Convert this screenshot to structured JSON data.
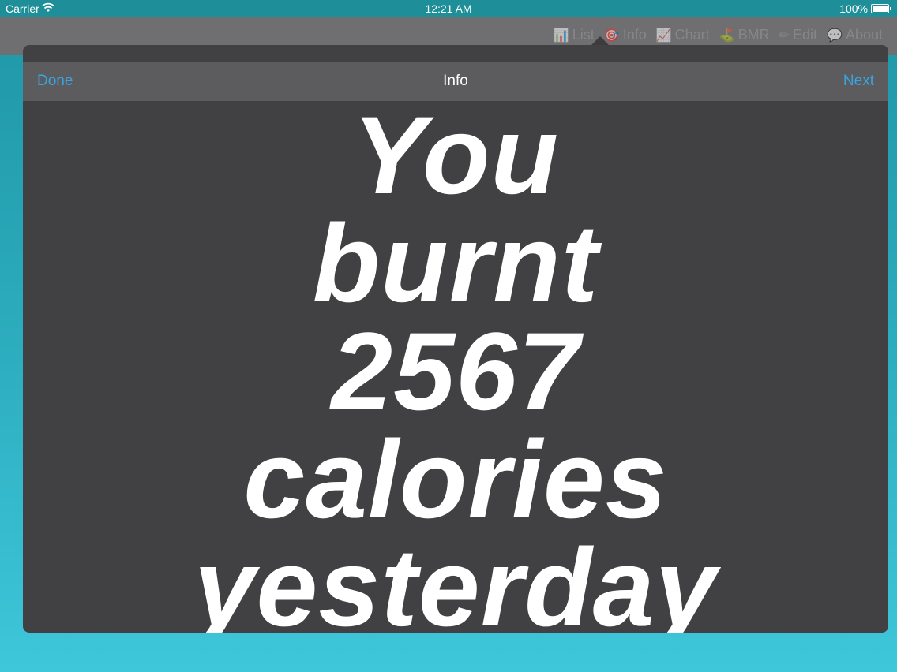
{
  "status_bar": {
    "carrier": "Carrier",
    "time": "12:21 AM",
    "battery": "100%"
  },
  "toolbar": {
    "items": [
      {
        "label": "List",
        "icon": "bar-chart-icon"
      },
      {
        "label": "Info",
        "icon": "target-icon"
      },
      {
        "label": "Chart",
        "icon": "line-chart-icon"
      },
      {
        "label": "BMR",
        "icon": "bmr-icon"
      },
      {
        "label": "Edit",
        "icon": "pencil-icon"
      },
      {
        "label": "About",
        "icon": "speech-bubble-icon"
      }
    ]
  },
  "popover": {
    "done_label": "Done",
    "title": "Info",
    "next_label": "Next",
    "message_lines": [
      "You",
      "burnt",
      "2567",
      "calories",
      "yesterday"
    ]
  },
  "colors": {
    "accent": "#3aa4e0",
    "popover_bg": "#414143",
    "nav_bg": "#5c5c5e",
    "background_top": "#1f96a6",
    "background_bottom": "#3ec6da"
  }
}
